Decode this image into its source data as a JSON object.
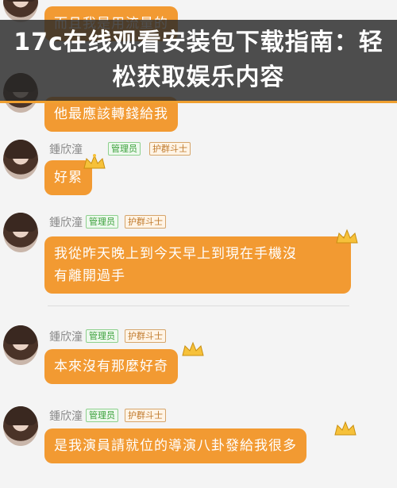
{
  "overlay": {
    "headline": "17c在线观看安装包下载指南：轻松获取娱乐内容"
  },
  "messages": [
    {
      "text": "而且我是用流量的"
    },
    {
      "text": "他最應該轉錢給我"
    },
    {
      "user": "鍾欣潼",
      "badge_admin": "管理员",
      "badge_level": "护群斗士",
      "text": "好累"
    },
    {
      "user": "鍾欣潼",
      "badge_admin": "管理员",
      "badge_level": "护群斗士",
      "text_line1": "我從昨天晚上到今天早上到現在手機沒",
      "text_line2": "有離開過手"
    },
    {
      "user": "鍾欣潼",
      "badge_admin": "管理员",
      "badge_level": "护群斗士",
      "text": "本來沒有那麼好奇"
    },
    {
      "user": "鍾欣潼",
      "badge_admin": "管理员",
      "badge_level": "护群斗士",
      "text": "是我演員請就位的導演八卦發給我很多"
    }
  ],
  "colors": {
    "bubble": "#f29a32",
    "overlay_accent": "#f0a030",
    "badge_admin": "#3aa03a",
    "badge_level": "#c07a2c"
  },
  "icons": [
    "avatar",
    "crown-icon"
  ]
}
